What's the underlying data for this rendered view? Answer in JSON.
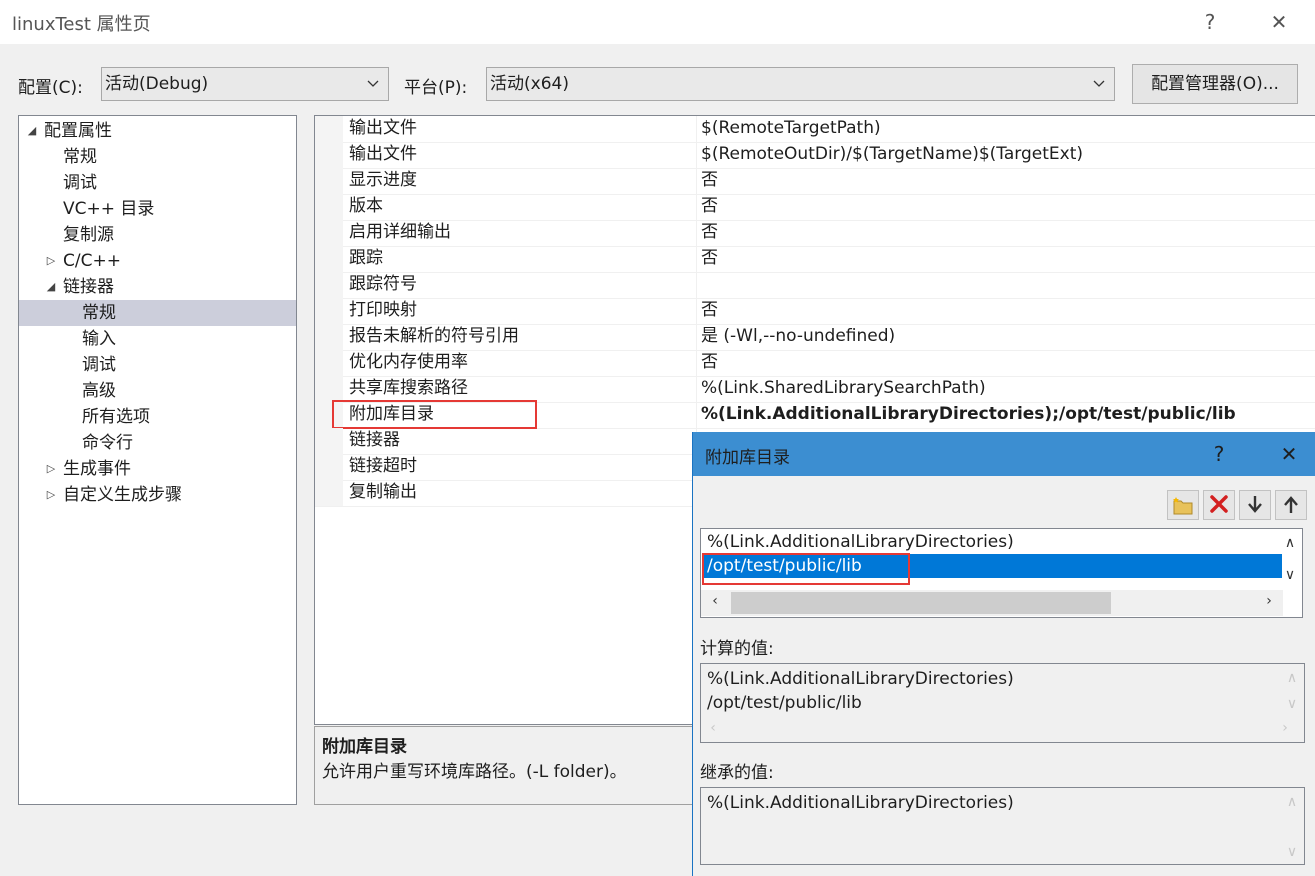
{
  "window": {
    "title": "linuxTest 属性页",
    "help_label": "?",
    "close_label": "✕"
  },
  "config_bar": {
    "config_label": "配置(C):",
    "config_value": "活动(Debug)",
    "platform_label": "平台(P):",
    "platform_value": "活动(x64)",
    "manager_button": "配置管理器(O)..."
  },
  "tree": [
    {
      "label": "配置属性",
      "toggle": "◢"
    },
    {
      "label": "常规",
      "toggle": ""
    },
    {
      "label": "调试",
      "toggle": ""
    },
    {
      "label": "VC++ 目录",
      "toggle": ""
    },
    {
      "label": "复制源",
      "toggle": ""
    },
    {
      "label": "C/C++",
      "toggle": "▷"
    },
    {
      "label": "链接器",
      "toggle": "◢"
    },
    {
      "label": "常规",
      "toggle": "",
      "selected": true
    },
    {
      "label": "输入",
      "toggle": ""
    },
    {
      "label": "调试",
      "toggle": ""
    },
    {
      "label": "高级",
      "toggle": ""
    },
    {
      "label": "所有选项",
      "toggle": ""
    },
    {
      "label": "命令行",
      "toggle": ""
    },
    {
      "label": "生成事件",
      "toggle": "▷"
    },
    {
      "label": "自定义生成步骤",
      "toggle": "▷"
    }
  ],
  "properties": [
    {
      "name": "输出文件",
      "value": "$(RemoteTargetPath)"
    },
    {
      "name": "输出文件",
      "value": "$(RemoteOutDir)/$(TargetName)$(TargetExt)"
    },
    {
      "name": "显示进度",
      "value": "否"
    },
    {
      "name": "版本",
      "value": "否"
    },
    {
      "name": "启用详细输出",
      "value": "否"
    },
    {
      "name": "跟踪",
      "value": "否"
    },
    {
      "name": "跟踪符号",
      "value": ""
    },
    {
      "name": "打印映射",
      "value": "否"
    },
    {
      "name": "报告未解析的符号引用",
      "value": "是 (-Wl,--no-undefined)"
    },
    {
      "name": "优化内存使用率",
      "value": "否"
    },
    {
      "name": "共享库搜索路径",
      "value": "%(Link.SharedLibrarySearchPath)"
    },
    {
      "name": "附加库目录",
      "value": "%(Link.AdditionalLibraryDirectories);/opt/test/public/lib",
      "bold": true,
      "highlighted": true
    },
    {
      "name": "链接器",
      "value": ""
    },
    {
      "name": "链接超时",
      "value": ""
    },
    {
      "name": "复制输出",
      "value": ""
    }
  ],
  "description": {
    "title": "附加库目录",
    "text": "允许用户重写环境库路径。(-L folder)。"
  },
  "dialog": {
    "title": "附加库目录",
    "help_label": "?",
    "close_label": "✕",
    "entries": [
      "%(Link.AdditionalLibraryDirectories)",
      "/opt/test/public/lib"
    ],
    "computed_label": "计算的值:",
    "computed_values": [
      "%(Link.AdditionalLibraryDirectories)",
      "/opt/test/public/lib"
    ],
    "inherited_label": "继承的值:",
    "inherited_values": [
      "%(Link.AdditionalLibraryDirectories)"
    ]
  }
}
